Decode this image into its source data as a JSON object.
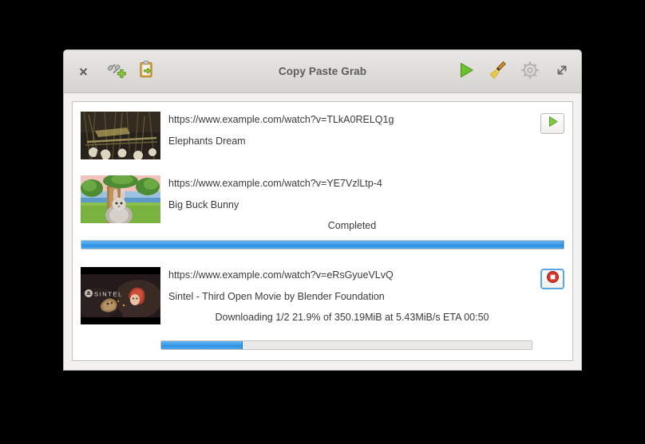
{
  "window": {
    "title": "Copy Paste Grab"
  },
  "toolbar": {
    "close_label": "Close",
    "close_icon": "close-icon",
    "left_buttons": [
      {
        "name": "add-link-button",
        "icon": "link-add-icon",
        "tooltip": "Add link"
      },
      {
        "name": "paste-clipboard-button",
        "icon": "clipboard-paste-icon",
        "tooltip": "Paste from clipboard"
      }
    ],
    "right_buttons": [
      {
        "name": "start-all-button",
        "icon": "play-icon",
        "tooltip": "Start all"
      },
      {
        "name": "clear-button",
        "icon": "broom-icon",
        "tooltip": "Clear finished"
      },
      {
        "name": "settings-button",
        "icon": "gear-icon",
        "tooltip": "Settings"
      },
      {
        "name": "fullscreen-button",
        "icon": "expand-arrows-icon",
        "tooltip": "Fullscreen"
      }
    ]
  },
  "colors": {
    "accent_blue": "#3d9ce8",
    "play_green": "#6cc22e",
    "stop_red": "#d8342a",
    "focus_blue": "#5aa7e8",
    "titlebar_text": "#5c5c5c",
    "body_text": "#3b3b3b"
  },
  "downloads": [
    {
      "url": "https://www.example.com/watch?v=TLkA0RELQ1g",
      "title": "Elephants Dream",
      "status": "",
      "progress_percent": null,
      "action_icon": "play-icon",
      "action_name": "start-download-button",
      "thumbnail": "elephants-dream-thumbnail"
    },
    {
      "url": "https://www.example.com/watch?v=YE7VzlLtp-4",
      "title": "Big Buck Bunny",
      "status": "Completed",
      "progress_percent": 100,
      "action_icon": null,
      "action_name": null,
      "thumbnail": "big-buck-bunny-thumbnail"
    },
    {
      "url": "https://www.example.com/watch?v=eRsGyueVLvQ",
      "title": "Sintel - Third Open Movie by Blender Foundation",
      "status": "Downloading 1/2   21.9% of 350.19MiB at  5.43MiB/s ETA 00:50",
      "progress_percent": 21.9,
      "action_icon": "stop-icon",
      "action_name": "stop-download-button",
      "thumbnail": "sintel-thumbnail"
    }
  ]
}
